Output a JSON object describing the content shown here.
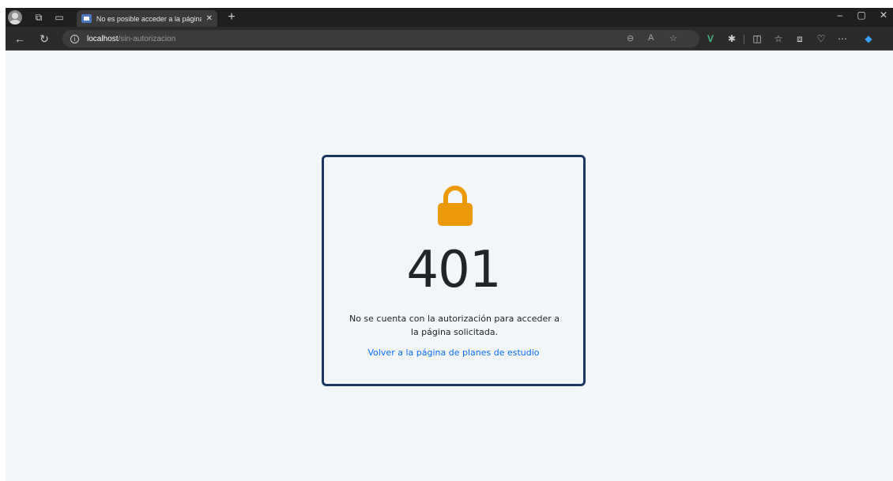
{
  "browser": {
    "tab_title": "No es posible acceder a la página",
    "url_host": "localhost",
    "url_path": "/sin-autorizacion"
  },
  "page": {
    "error_code": "401",
    "message": "No se cuenta con la autorización para acceder a la página solicitada.",
    "back_link": "Volver a la página de planes de estudio"
  },
  "colors": {
    "lock": "#ec9a0c",
    "card_border": "#1b3764",
    "link": "#0d6efd",
    "page_bg": "#f3f6f9"
  },
  "icons": [
    "profile-icon",
    "workspaces-icon",
    "tab-actions-icon",
    "close-icon",
    "plus-icon",
    "minimize-icon",
    "restore-icon",
    "back-arrow-icon",
    "refresh-icon",
    "info-icon",
    "zoom-icon",
    "read-aloud-icon",
    "favorite-star-icon",
    "vue-devtools-icon",
    "extensions-icon",
    "split-screen-icon",
    "favorites-icon",
    "collections-icon",
    "browser-essentials-icon",
    "more-icon",
    "copilot-icon",
    "lock-icon"
  ]
}
